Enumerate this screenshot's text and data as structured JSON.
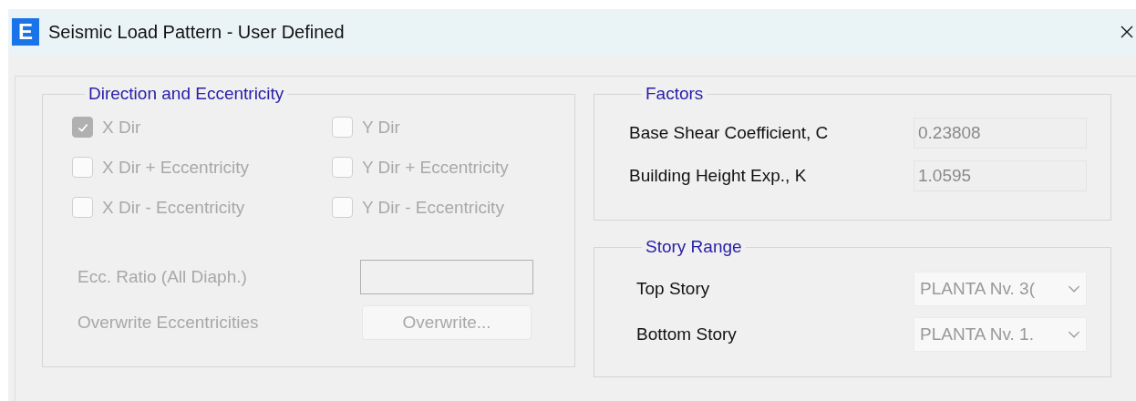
{
  "window": {
    "icon_letter": "E",
    "title": "Seismic Load Pattern - User Defined"
  },
  "direction": {
    "title": "Direction and Eccentricity",
    "disabled": true,
    "options": [
      {
        "label": "X Dir",
        "checked": true
      },
      {
        "label": "Y Dir",
        "checked": false
      },
      {
        "label": "X Dir + Eccentricity",
        "checked": false
      },
      {
        "label": "Y Dir + Eccentricity",
        "checked": false
      },
      {
        "label": "X Dir - Eccentricity",
        "checked": false
      },
      {
        "label": "Y Dir - Eccentricity",
        "checked": false
      }
    ],
    "ecc_ratio_label": "Ecc. Ratio (All Diaph.)",
    "overwrite_label": "Overwrite Eccentricities",
    "overwrite_button": "Overwrite..."
  },
  "factors": {
    "title": "Factors",
    "rows": [
      {
        "label": "Base Shear Coefficient, C",
        "value": "0.23808"
      },
      {
        "label": "Building Height Exp., K",
        "value": "1.0595"
      }
    ]
  },
  "story_range": {
    "title": "Story Range",
    "rows": [
      {
        "label": "Top Story",
        "value": "PLANTA Nv. 3("
      },
      {
        "label": "Bottom Story",
        "value": "PLANTA Nv. 1."
      }
    ]
  }
}
